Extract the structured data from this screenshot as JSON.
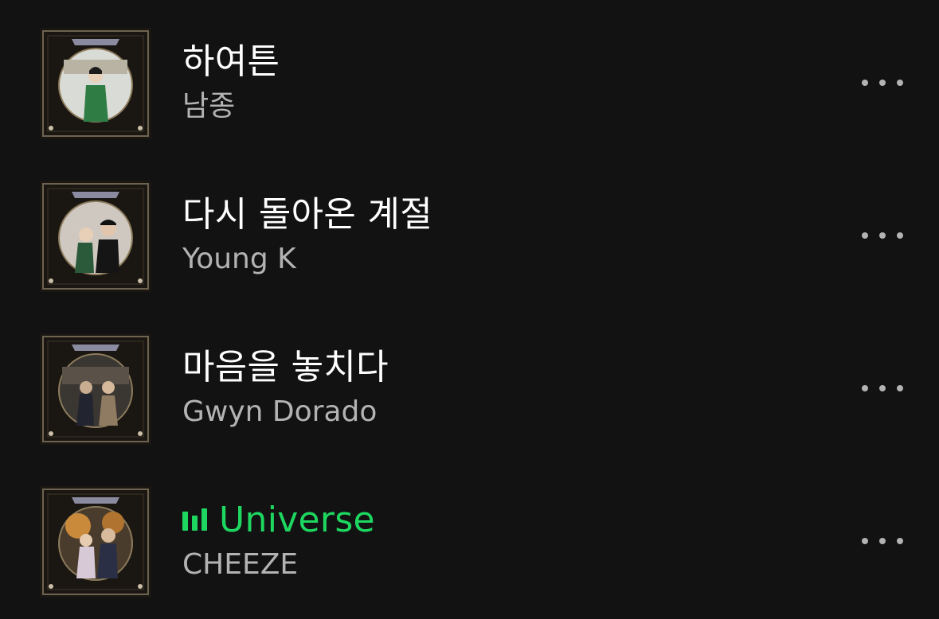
{
  "colors": {
    "background": "#121212",
    "title": "#ffffff",
    "artist": "#b3b3b3",
    "playing": "#1ed760"
  },
  "tracks": [
    {
      "title": "하여튼",
      "artist": "남종",
      "playing": false,
      "icon_more": "more-horizontal-icon"
    },
    {
      "title": "다시 돌아온 계절",
      "artist": "Young K",
      "playing": false,
      "icon_more": "more-horizontal-icon"
    },
    {
      "title": "마음을 놓치다",
      "artist": "Gwyn Dorado",
      "playing": false,
      "icon_more": "more-horizontal-icon"
    },
    {
      "title": "Universe",
      "artist": "CHEEZE",
      "playing": true,
      "icon_playing": "equalizer-icon",
      "icon_more": "more-horizontal-icon"
    }
  ]
}
